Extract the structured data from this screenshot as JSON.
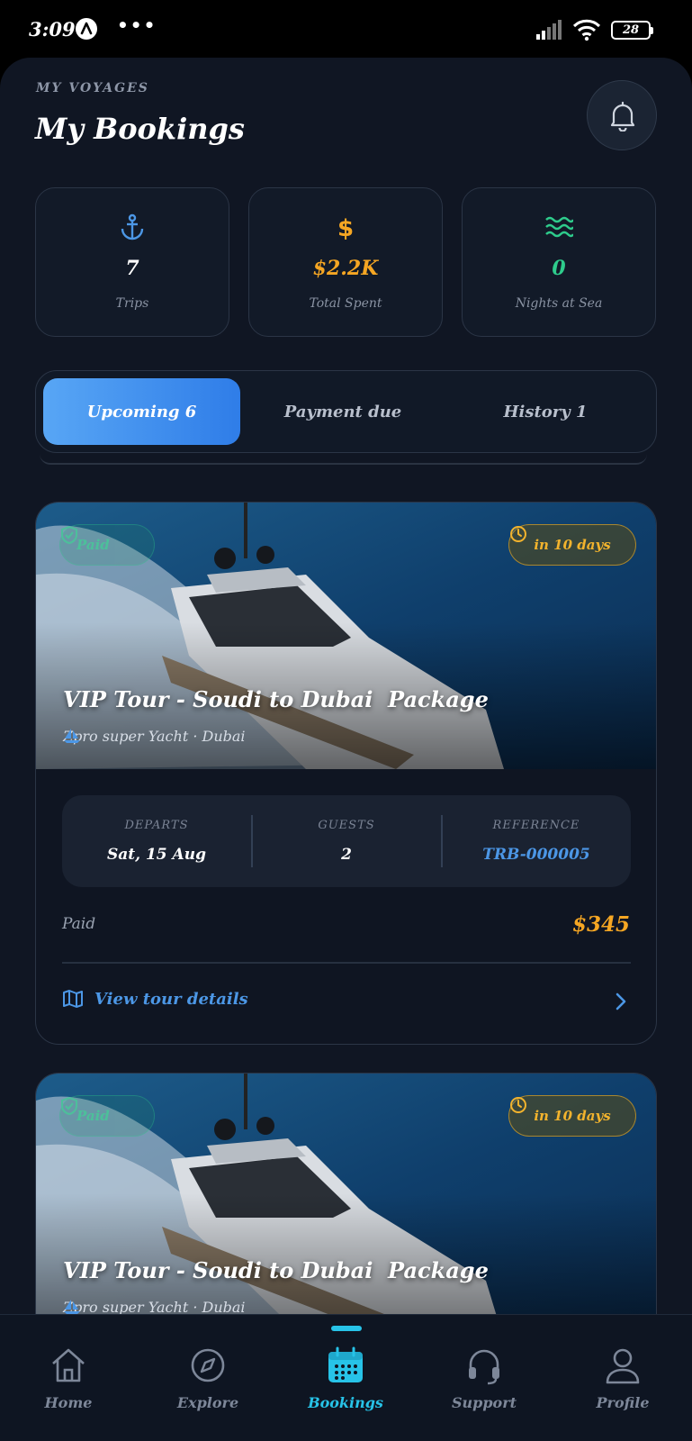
{
  "status_bar": {
    "time": "3:09",
    "dots": "•••",
    "battery": "28"
  },
  "header": {
    "eyebrow": "MY VOYAGES",
    "title": "My Bookings"
  },
  "stats": [
    {
      "icon": "anchor-icon",
      "value": "7",
      "label": "Trips",
      "color": "#4c97e6"
    },
    {
      "icon": "dollar-icon",
      "value": "$2.2K",
      "label": "Total Spent",
      "color": "#f5a623"
    },
    {
      "icon": "waves-icon",
      "value": "0",
      "label": "Nights at Sea",
      "color": "#2ecc8c"
    }
  ],
  "tabs": [
    {
      "label": "Upcoming 6",
      "active": true
    },
    {
      "label": "Payment due",
      "active": false
    },
    {
      "label": "History 1",
      "active": false
    }
  ],
  "bookings": [
    {
      "status": "Paid",
      "countdown": "in 10 days",
      "title": "VIP Tour - Soudi to Dubai  Package",
      "subtitle": "Zpro super Yacht · Dubai",
      "departs_label": "DEPARTS",
      "departs": "Sat, 15 Aug",
      "guests_label": "GUESTS",
      "guests": "2",
      "reference_label": "REFERENCE",
      "reference": "TRB-000005",
      "payment_label": "Paid",
      "amount": "$345",
      "link": "View tour details"
    },
    {
      "status": "Paid",
      "countdown": "in 10 days",
      "title": "VIP Tour - Soudi to Dubai  Package",
      "subtitle": "Zpro super Yacht · Dubai"
    }
  ],
  "nav": [
    {
      "label": "Home",
      "icon": "home-icon",
      "active": false
    },
    {
      "label": "Explore",
      "icon": "compass-icon",
      "active": false
    },
    {
      "label": "Bookings",
      "icon": "calendar-icon",
      "active": true
    },
    {
      "label": "Support",
      "icon": "headset-icon",
      "active": false
    },
    {
      "label": "Profile",
      "icon": "user-icon",
      "active": false
    }
  ],
  "colors": {
    "accent": "#27c3e8",
    "link": "#4c97e6",
    "amount": "#f5a623",
    "paid": "#3ad08f",
    "background": "#101623"
  }
}
